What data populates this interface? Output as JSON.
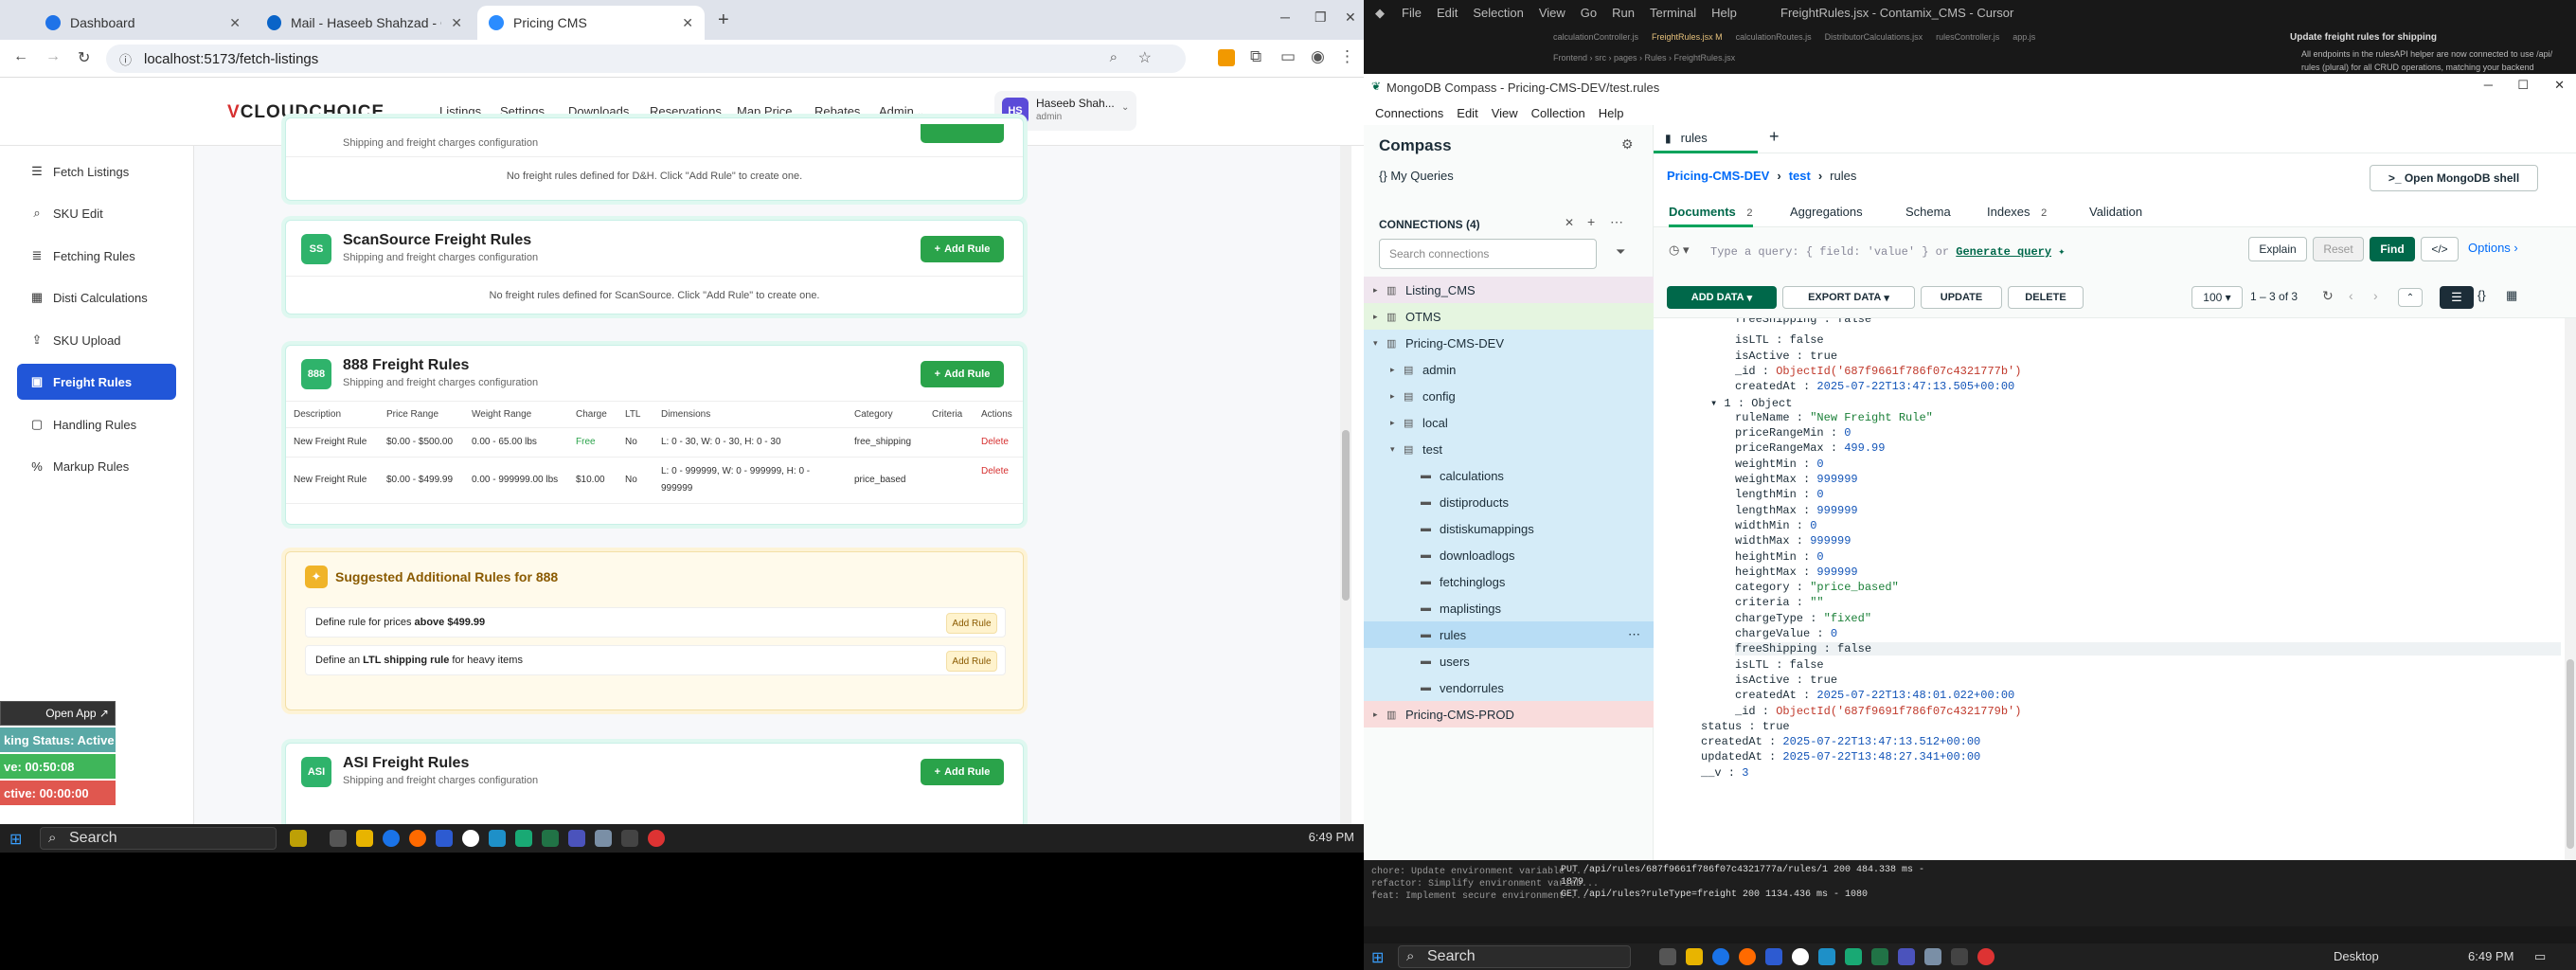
{
  "browser": {
    "tabs": [
      {
        "label": "Dashboard"
      },
      {
        "label": "Mail - Haseeb Shahzad - Outlo"
      },
      {
        "label": "Pricing CMS"
      }
    ],
    "url": "localhost:5173/fetch-listings"
  },
  "app": {
    "logo_prefix": "V",
    "logo_text": "CLOUDCHOICE",
    "nav": [
      "Listings",
      "Settings",
      "Downloads",
      "Reservations",
      "Map Price",
      "Rebates",
      "Admin"
    ],
    "user": {
      "initials": "HS",
      "name": "Haseeb Shah...",
      "role": "admin"
    },
    "sidebar": [
      {
        "label": "Fetch Listings"
      },
      {
        "label": "SKU Edit"
      },
      {
        "label": "Fetching Rules"
      },
      {
        "label": "Disti Calculations"
      },
      {
        "label": "SKU Upload"
      },
      {
        "label": "Freight Rules"
      },
      {
        "label": "Handling Rules"
      },
      {
        "label": "Markup Rules"
      }
    ],
    "top_card": {
      "subtitle": "Shipping and freight charges configuration",
      "empty": "No freight rules defined for D&H. Click \"Add Rule\" to create one."
    },
    "scansource": {
      "badge": "SS",
      "title": "ScanSource Freight Rules",
      "subtitle": "Shipping and freight charges configuration",
      "add": "Add Rule",
      "empty": "No freight rules defined for ScanSource. Click \"Add Rule\" to create one."
    },
    "card888": {
      "badge": "888",
      "title": "888 Freight Rules",
      "subtitle": "Shipping and freight charges configuration",
      "add": "Add Rule",
      "columns": [
        "Description",
        "Price Range",
        "Weight Range",
        "Charge",
        "LTL",
        "Dimensions",
        "Category",
        "Criteria",
        "Actions"
      ],
      "rows": [
        {
          "desc": "New Freight Rule",
          "price": "$0.00 - $500.00",
          "weight": "0.00 - 65.00 lbs",
          "charge": "Free",
          "ltl": "No",
          "dims": "L: 0 - 30, W: 0 - 30, H: 0 - 30",
          "category": "free_shipping",
          "criteria": "",
          "action": "Delete"
        },
        {
          "desc": "New Freight Rule",
          "price": "$0.00 - $499.99",
          "weight": "0.00 - 999999.00 lbs",
          "charge": "$10.00",
          "ltl": "No",
          "dims": "L: 0 - 999999, W: 0 - 999999, H: 0 - 999999",
          "category": "price_based",
          "criteria": "",
          "action": "Delete"
        }
      ]
    },
    "suggested": {
      "title": "Suggested Additional Rules for 888",
      "rows": [
        {
          "pre": "Define rule for prices ",
          "bold": "above $499.99",
          "post": "",
          "btn": "Add Rule"
        },
        {
          "pre": "Define an ",
          "bold": "LTL shipping rule",
          "post": " for heavy items",
          "btn": "Add Rule"
        }
      ]
    },
    "asi": {
      "badge": "ASI",
      "title": "ASI Freight Rules",
      "subtitle": "Shipping and freight charges configuration",
      "add": "Add Rule"
    },
    "float_panel": {
      "open": "Open App ↗",
      "status": "king Status: Active",
      "active": "ve: 00:50:08",
      "inactive": "ctive: 00:00:00"
    }
  },
  "left_taskbar": {
    "search": "Search",
    "time": "6:49 PM"
  },
  "cursor": {
    "menu": [
      "File",
      "Edit",
      "Selection",
      "View",
      "Go",
      "Run",
      "Terminal",
      "Help"
    ],
    "title": "FreightRules.jsx - Contamix_CMS - Cursor",
    "tabs": [
      "calculationController.js",
      "FreightRules.jsx M",
      "calculationRoutes.js",
      "DistributorCalculations.jsx",
      "rulesController.js",
      "app.js"
    ],
    "breadcrumb": "Frontend › src › pages › Rules › FreightRules.jsx",
    "chat_title": "Update freight rules for shipping",
    "chat_line1": "All endpoints in the  rulesAPI  helper are now connected to use  /api/",
    "chat_line2": "rules  (plural) for all CRUD operations, matching your backend"
  },
  "compass": {
    "window_title": "MongoDB Compass - Pricing-CMS-DEV/test.rules",
    "menu": [
      "Connections",
      "Edit",
      "View",
      "Collection",
      "Help"
    ],
    "tab_label": "rules",
    "brand": "Compass",
    "my_queries": "My Queries",
    "connections_label": "CONNECTIONS (4)",
    "search_placeholder": "Search connections",
    "tree": [
      {
        "label": "Listing_CMS",
        "level": 0,
        "kind": "conn"
      },
      {
        "label": "OTMS",
        "level": 0,
        "kind": "conn"
      },
      {
        "label": "Pricing-CMS-DEV",
        "level": 0,
        "kind": "conn-open"
      },
      {
        "label": "admin",
        "level": 1,
        "kind": "db"
      },
      {
        "label": "config",
        "level": 1,
        "kind": "db"
      },
      {
        "label": "local",
        "level": 1,
        "kind": "db"
      },
      {
        "label": "test",
        "level": 1,
        "kind": "db-open"
      },
      {
        "label": "calculations",
        "level": 2,
        "kind": "coll"
      },
      {
        "label": "distiproducts",
        "level": 2,
        "kind": "coll"
      },
      {
        "label": "distiskumappings",
        "level": 2,
        "kind": "coll"
      },
      {
        "label": "downloadlogs",
        "level": 2,
        "kind": "coll"
      },
      {
        "label": "fetchinglogs",
        "level": 2,
        "kind": "coll"
      },
      {
        "label": "maplistings",
        "level": 2,
        "kind": "coll"
      },
      {
        "label": "rules",
        "level": 2,
        "kind": "coll-sel"
      },
      {
        "label": "users",
        "level": 2,
        "kind": "coll"
      },
      {
        "label": "vendorrules",
        "level": 2,
        "kind": "coll"
      },
      {
        "label": "Pricing-CMS-PROD",
        "level": 0,
        "kind": "conn-prod"
      }
    ],
    "breadcrumb": [
      "Pricing-CMS-DEV",
      "test",
      "rules"
    ],
    "open_shell": ">_ Open MongoDB shell",
    "subtabs": [
      {
        "label": "Documents",
        "count": "2"
      },
      {
        "label": "Aggregations",
        "count": ""
      },
      {
        "label": "Schema",
        "count": ""
      },
      {
        "label": "Indexes",
        "count": "2"
      },
      {
        "label": "Validation",
        "count": ""
      }
    ],
    "query_placeholder": "Type a query: { field: 'value' } or",
    "generate_query": "Generate query",
    "explain": "Explain",
    "reset": "Reset",
    "find": "Find",
    "options": "Options ›",
    "add_data": "ADD DATA",
    "export_data": "EXPORT DATA",
    "update": "UPDATE",
    "delete": "DELETE",
    "page_size": "100",
    "range": "1 – 3 of 3",
    "doc_lines": [
      {
        "indent": 0,
        "key": "freeShipping",
        "val": "false",
        "t": "bool",
        "clip": true
      },
      {
        "indent": 0,
        "key": "isLTL",
        "val": "false",
        "t": "bool"
      },
      {
        "indent": 0,
        "key": "isActive",
        "val": "true",
        "t": "bool"
      },
      {
        "indent": 0,
        "key": "_id",
        "val": "ObjectId('687f9661f786f07c4321777b')",
        "t": "oid"
      },
      {
        "indent": 0,
        "key": "createdAt",
        "val": "2025-07-22T13:47:13.505+00:00",
        "t": "num"
      },
      {
        "indent": -1,
        "key": "▾ 1",
        "val": "Object",
        "t": "bool"
      },
      {
        "indent": 0,
        "key": "ruleName",
        "val": "\"New Freight Rule\"",
        "t": "str"
      },
      {
        "indent": 0,
        "key": "priceRangeMin",
        "val": "0",
        "t": "num"
      },
      {
        "indent": 0,
        "key": "priceRangeMax",
        "val": "499.99",
        "t": "num"
      },
      {
        "indent": 0,
        "key": "weightMin",
        "val": "0",
        "t": "num"
      },
      {
        "indent": 0,
        "key": "weightMax",
        "val": "999999",
        "t": "num"
      },
      {
        "indent": 0,
        "key": "lengthMin",
        "val": "0",
        "t": "num"
      },
      {
        "indent": 0,
        "key": "lengthMax",
        "val": "999999",
        "t": "num"
      },
      {
        "indent": 0,
        "key": "widthMin",
        "val": "0",
        "t": "num"
      },
      {
        "indent": 0,
        "key": "widthMax",
        "val": "999999",
        "t": "num"
      },
      {
        "indent": 0,
        "key": "heightMin",
        "val": "0",
        "t": "num"
      },
      {
        "indent": 0,
        "key": "heightMax",
        "val": "999999",
        "t": "num"
      },
      {
        "indent": 0,
        "key": "category",
        "val": "\"price_based\"",
        "t": "str"
      },
      {
        "indent": 0,
        "key": "criteria",
        "val": "\"\"",
        "t": "str"
      },
      {
        "indent": 0,
        "key": "chargeType",
        "val": "\"fixed\"",
        "t": "str"
      },
      {
        "indent": 0,
        "key": "chargeValue",
        "val": "0",
        "t": "num"
      },
      {
        "indent": 0,
        "key": "freeShipping",
        "val": "false",
        "t": "bool",
        "hl": true
      },
      {
        "indent": 0,
        "key": "isLTL",
        "val": "false",
        "t": "bool"
      },
      {
        "indent": 0,
        "key": "isActive",
        "val": "true",
        "t": "bool"
      },
      {
        "indent": 0,
        "key": "createdAt",
        "val": "2025-07-22T13:48:01.022+00:00",
        "t": "num"
      },
      {
        "indent": 0,
        "key": "_id",
        "val": "ObjectId('687f9691f786f07c4321779b')",
        "t": "oid"
      },
      {
        "indent": -2,
        "key": "status",
        "val": "true",
        "t": "bool"
      },
      {
        "indent": -2,
        "key": "createdAt",
        "val": "2025-07-22T13:47:13.512+00:00",
        "t": "num"
      },
      {
        "indent": -2,
        "key": "updatedAt",
        "val": "2025-07-22T13:48:27.341+00:00",
        "t": "num"
      },
      {
        "indent": -2,
        "key": "__v",
        "val": "3",
        "t": "num"
      }
    ]
  },
  "terminal": {
    "left_lines": [
      "chore: Update environment variable ...",
      "refactor: Simplify environment variab...",
      "feat: Implement secure environment ..."
    ],
    "lines": [
      "PUT /api/rules/687f9661f786f07c4321777a/rules/1 200 484.338 ms -",
      "1879",
      "GET /api/rules?ruleType=freight 200 1134.436 ms - 1080"
    ]
  },
  "right_taskbar": {
    "search": "Search",
    "desktop": "Desktop",
    "time": "6:49 PM"
  }
}
